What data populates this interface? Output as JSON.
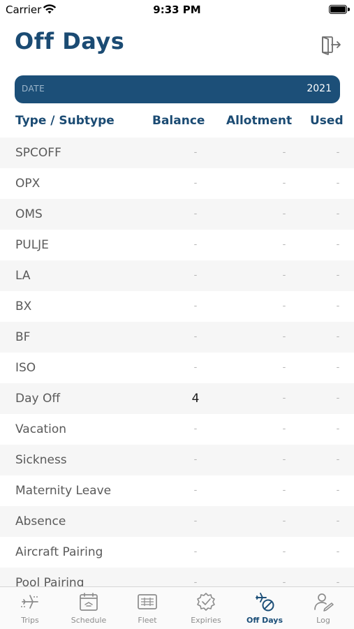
{
  "status_bar": {
    "carrier": "Carrier",
    "time": "9:33 PM"
  },
  "header": {
    "title": "Off Days"
  },
  "date_bar": {
    "label": "DATE",
    "year": "2021"
  },
  "columns": {
    "type": "Type / Subtype",
    "balance": "Balance",
    "allotment": "Allotment",
    "used": "Used"
  },
  "rows": [
    {
      "type": "SPCOFF",
      "balance": "-",
      "allotment": "-",
      "used": "-"
    },
    {
      "type": "OPX",
      "balance": "-",
      "allotment": "-",
      "used": "-"
    },
    {
      "type": "OMS",
      "balance": "-",
      "allotment": "-",
      "used": "-"
    },
    {
      "type": "PULJE",
      "balance": "-",
      "allotment": "-",
      "used": "-"
    },
    {
      "type": "LA",
      "balance": "-",
      "allotment": "-",
      "used": "-"
    },
    {
      "type": "BX",
      "balance": "-",
      "allotment": "-",
      "used": "-"
    },
    {
      "type": "BF",
      "balance": "-",
      "allotment": "-",
      "used": "-"
    },
    {
      "type": "ISO",
      "balance": "-",
      "allotment": "-",
      "used": "-"
    },
    {
      "type": "Day Off",
      "balance": "4",
      "allotment": "-",
      "used": "-"
    },
    {
      "type": "Vacation",
      "balance": "-",
      "allotment": "-",
      "used": "-"
    },
    {
      "type": "Sickness",
      "balance": "-",
      "allotment": "-",
      "used": "-"
    },
    {
      "type": "Maternity Leave",
      "balance": "-",
      "allotment": "-",
      "used": "-"
    },
    {
      "type": "Absence",
      "balance": "-",
      "allotment": "-",
      "used": "-"
    },
    {
      "type": "Aircraft Pairing",
      "balance": "-",
      "allotment": "-",
      "used": "-"
    },
    {
      "type": "Pool Pairing",
      "balance": "-",
      "allotment": "-",
      "used": "-"
    }
  ],
  "tabs": [
    {
      "label": "Trips",
      "icon": "airplane-icon",
      "active": false
    },
    {
      "label": "Schedule",
      "icon": "calendar-icon",
      "active": false
    },
    {
      "label": "Fleet",
      "icon": "fleet-grid-icon",
      "active": false
    },
    {
      "label": "Expiries",
      "icon": "badge-check-icon",
      "active": false
    },
    {
      "label": "Off Days",
      "icon": "plane-cancel-icon",
      "active": true
    },
    {
      "label": "Log",
      "icon": "person-log-icon",
      "active": false
    }
  ],
  "colors": {
    "primary": "#1c4f78",
    "title": "#1b4b73",
    "row_alt": "#f6f6f6",
    "inactive": "#8c8c8c"
  }
}
